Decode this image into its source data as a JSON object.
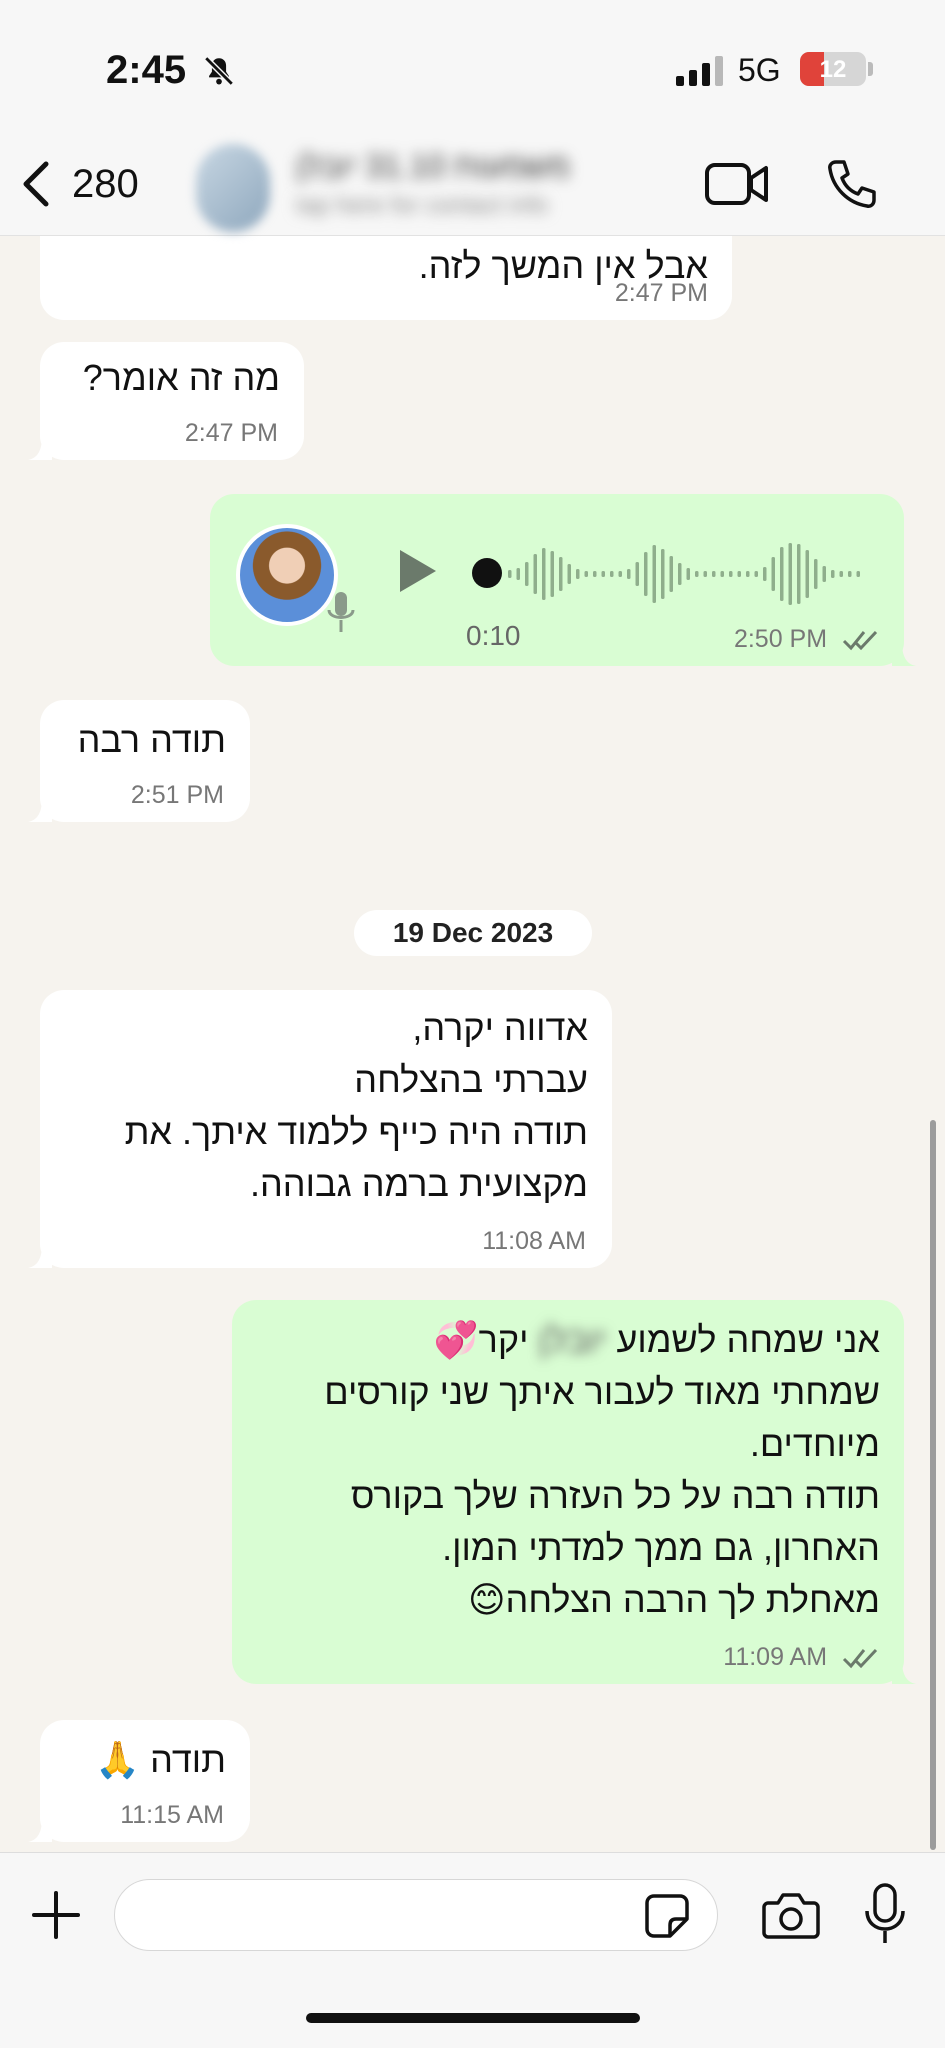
{
  "status_bar": {
    "time": "2:45",
    "network": "5G",
    "battery": "12"
  },
  "header": {
    "back_count": "280",
    "contact_name": "משמעות 31.10 יובלן",
    "contact_subtitle": "tap here for contact info"
  },
  "messages": [
    {
      "id": "m1",
      "direction": "in",
      "text": "אבל אין המשך לזה.",
      "time": "2:47 PM"
    },
    {
      "id": "m2",
      "direction": "in",
      "text": "מה זה אומר?",
      "time": "2:47 PM"
    },
    {
      "id": "m3",
      "direction": "out",
      "type": "voice",
      "duration": "0:10",
      "time": "2:50 PM",
      "status": "read"
    },
    {
      "id": "m4",
      "direction": "in",
      "text": "תודה רבה",
      "time": "2:51 PM"
    },
    {
      "id": "m5",
      "direction": "in",
      "lines": [
        "אדווה יקרה,",
        "עברתי בהצלחה",
        "תודה היה כייף ללמוד איתך. את",
        "מקצועית ברמה גבוהה."
      ],
      "time": "11:08 AM"
    },
    {
      "id": "m6",
      "direction": "out",
      "line1_start": "אני שמחה לשמוע",
      "line1_blurred": "יובלן",
      "line1_end": "יקר💞",
      "lines": [
        "שמחתי מאוד לעבור איתך שני קורסים",
        "מיוחדים.",
        "תודה רבה על כל העזרה שלך בקורס",
        "האחרון, גם ממך למדתי המון.",
        "מאחלת לך הרבה הצלחה😊"
      ],
      "time": "11:09 AM",
      "status": "read"
    },
    {
      "id": "m7",
      "direction": "in",
      "text": "תודה 🙏",
      "time": "11:15 AM"
    }
  ],
  "date_separator": "19 Dec 2023",
  "composer": {
    "placeholder": ""
  },
  "colors": {
    "incoming": "#ffffff",
    "outgoing": "#d9fdd3",
    "read_check": "#53bdeb",
    "background": "#f6f3ee"
  },
  "icons": [
    "back-chevron-icon",
    "video-call-icon",
    "phone-call-icon",
    "play-icon",
    "mic-icon",
    "plus-icon",
    "sticker-icon",
    "camera-icon",
    "bell-off-icon",
    "signal-icon"
  ]
}
